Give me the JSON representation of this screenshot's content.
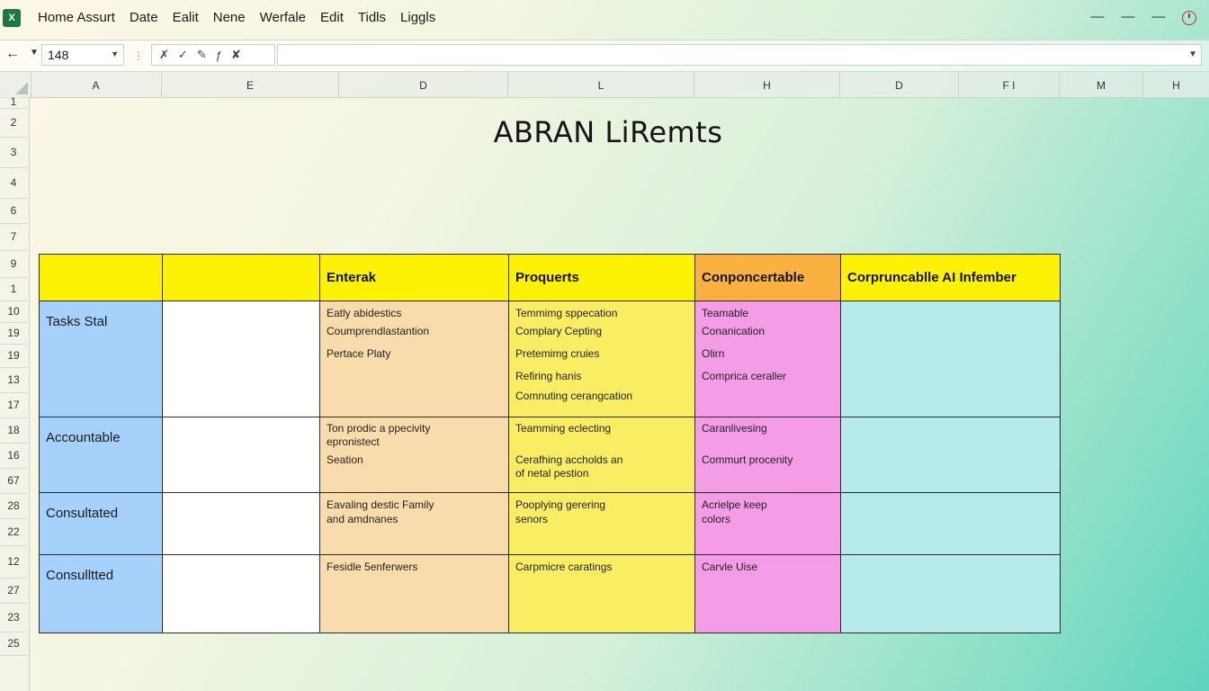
{
  "app": {
    "icon_label": "X",
    "menu": [
      "Home Assurt",
      "Date",
      "Ealit",
      "Nene",
      "Werfale",
      "Edit",
      "Tidls",
      "Liggls"
    ],
    "window_controls": [
      "—",
      "—",
      "—"
    ]
  },
  "formula_bar": {
    "name_box": "148",
    "formula_value": ""
  },
  "columns": [
    "A",
    "E",
    "D",
    "L",
    "H",
    "D",
    "F I",
    "M",
    "H"
  ],
  "rows": [
    "1",
    "2",
    "3",
    "4",
    "6",
    "7",
    "9",
    "1",
    "10",
    "19",
    "19",
    "13",
    "17",
    "18",
    "16",
    "67",
    "28",
    "22",
    "12",
    "27",
    "23",
    "25"
  ],
  "sheet_title": "ABRAN LiRemts",
  "table": {
    "headers": [
      "",
      "",
      "Enterak",
      "Proquerts",
      "Conponcertable",
      "Corpruncablle AI Infember"
    ],
    "rows": [
      {
        "label": "Tasks Stal",
        "cells": [
          [],
          [
            "Eatly abidestics",
            "Coumprendlastantion",
            "Pertace Platy"
          ],
          [
            "Temmimg sppecation",
            "Complary Cepting",
            "Pretemimg cruies",
            "Refiring hanis",
            "Comnuting cerangcation"
          ],
          [
            "Teamable",
            "Conanication",
            "Olirn",
            "Comprica ceraller"
          ],
          []
        ]
      },
      {
        "label": "Accountable",
        "cells": [
          [],
          [
            "Ton prodic a ppecivity",
            "epronistect",
            "Seation"
          ],
          [
            "Teamming eclecting",
            "Cerafhing accholds an",
            "of netal pestion"
          ],
          [
            "Caranlivesing",
            "Commurt procenity"
          ],
          []
        ]
      },
      {
        "label": "Consultated",
        "cells": [
          [],
          [
            "Eavaling destic Family",
            "and amdnanes"
          ],
          [
            "Pooplying gerering",
            "senors"
          ],
          [
            "Acrielpe keep",
            "colors"
          ],
          []
        ]
      },
      {
        "label": "Consulltted",
        "cells": [
          [],
          [
            "Fesidle 5enferwers"
          ],
          [
            "Carpmicre caratings"
          ],
          [
            "Carvle Uise"
          ],
          []
        ]
      }
    ]
  },
  "colors": {
    "header_yellow": "#fdf203",
    "header_orange": "#fbb13f",
    "role_blue": "#a6d1fb",
    "peach": "#f9dcab",
    "light_yellow": "#f9ee63",
    "pink": "#f59ce6",
    "teal": "#b5ecea"
  }
}
